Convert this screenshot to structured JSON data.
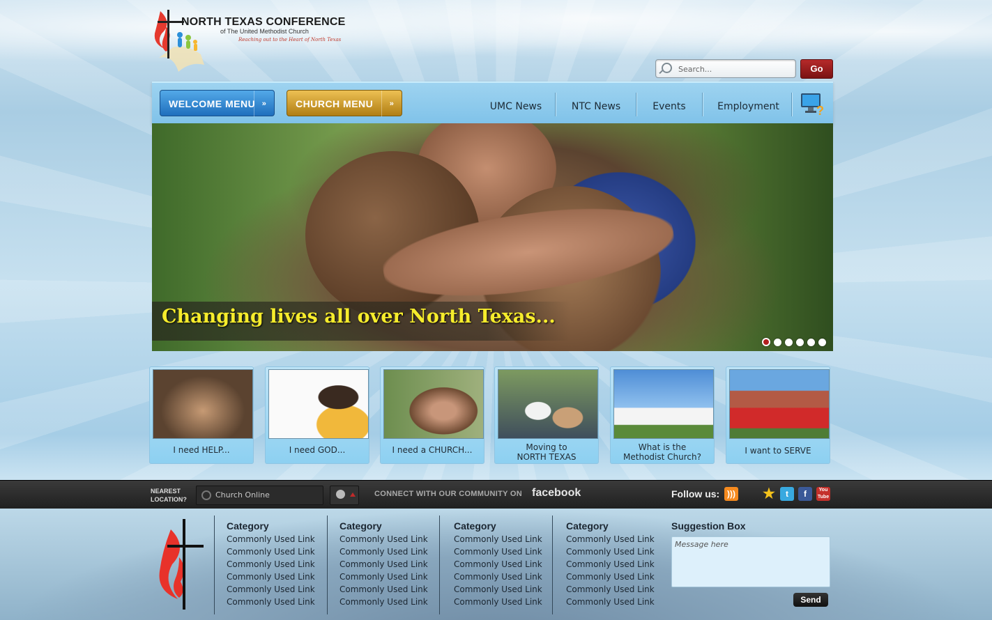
{
  "logo": {
    "title": "NORTH TEXAS CONFERENCE",
    "subtitle": "of The United Methodist Church",
    "tagline": "Reaching out to the Heart of North Texas"
  },
  "search": {
    "placeholder": "Search...",
    "go_label": "Go"
  },
  "nav": {
    "welcome_menu": "WELCOME MENU",
    "church_menu": "CHURCH MENU",
    "chevron": "»",
    "links": [
      "UMC News",
      "NTC News",
      "Events",
      "Employment"
    ],
    "help_icon": "computer-help-icon"
  },
  "hero": {
    "caption": "Changing lives all over North Texas...",
    "slides": 6,
    "active_slide": 1
  },
  "cards": [
    {
      "label": "I need HELP..."
    },
    {
      "label": "I need GOD..."
    },
    {
      "label": "I need a CHURCH..."
    },
    {
      "label": "Moving to\nNORTH TEXAS"
    },
    {
      "label": "What is the\nMethodist Church?"
    },
    {
      "label": "I  want to SERVE"
    }
  ],
  "footbar": {
    "nearest_label_1": "NEAREST",
    "nearest_label_2": "LOCATION?",
    "location_value": "Church Online",
    "connect_text": "CONNECT WITH OUR COMMUNITY ON",
    "facebook": "facebook",
    "follow_us": "Follow us:",
    "social_icons": [
      "rss-icon",
      "star-icon",
      "twitter-icon",
      "facebook-icon",
      "youtube-icon"
    ]
  },
  "footer": {
    "columns": [
      {
        "heading": "Category",
        "links": [
          "Commonly Used Link",
          "Commonly Used Link",
          "Commonly Used Link",
          "Commonly Used Link",
          "Commonly Used Link",
          "Commonly Used Link"
        ]
      },
      {
        "heading": "Category",
        "links": [
          "Commonly Used Link",
          "Commonly Used Link",
          "Commonly Used Link",
          "Commonly Used Link",
          "Commonly Used Link",
          "Commonly Used Link"
        ]
      },
      {
        "heading": "Category",
        "links": [
          "Commonly Used Link",
          "Commonly Used Link",
          "Commonly Used Link",
          "Commonly Used Link",
          "Commonly Used Link",
          "Commonly Used Link"
        ]
      },
      {
        "heading": "Category",
        "links": [
          "Commonly Used Link",
          "Commonly Used Link",
          "Commonly Used Link",
          "Commonly Used Link",
          "Commonly Used Link",
          "Commonly Used Link"
        ]
      }
    ],
    "suggestion_title": "Suggestion Box",
    "suggestion_placeholder": "Message here",
    "send_label": "Send"
  },
  "colors": {
    "accent_red": "#b21f1f",
    "welcome_blue": "#1f6fbd",
    "church_gold": "#b07e14",
    "caption_yellow": "#f6ec2c"
  }
}
